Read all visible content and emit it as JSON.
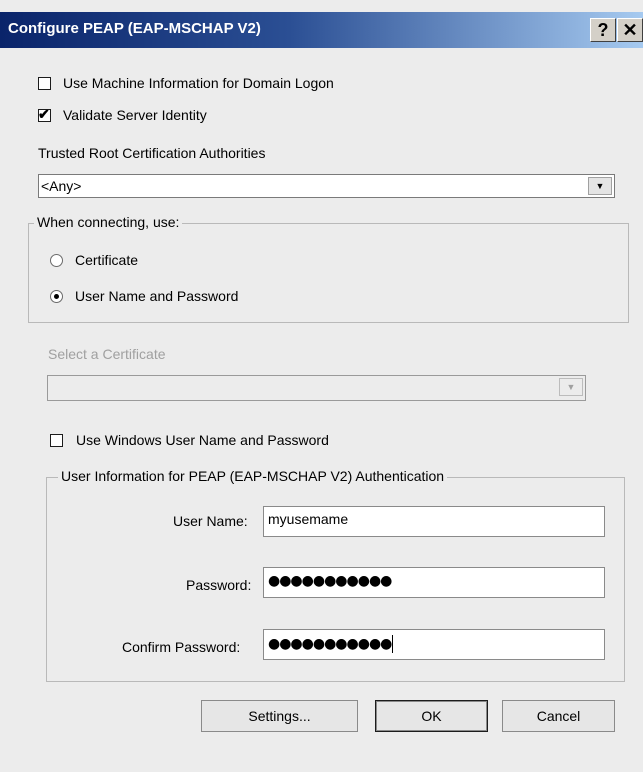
{
  "window": {
    "title": "Configure PEAP (EAP-MSCHAP V2)",
    "help_glyph": "?",
    "close_glyph": "✕"
  },
  "options": {
    "machine_info_label": "Use Machine Information for Domain Logon",
    "machine_info_checked": false,
    "validate_server_label": "Validate Server Identity",
    "validate_server_checked": true
  },
  "trusted_root": {
    "label": "Trusted Root Certification Authorities",
    "value": "<Any>"
  },
  "when_connecting": {
    "title": "When connecting, use:",
    "radio_certificate": "Certificate",
    "radio_username_password": "User Name and Password",
    "selected": "User Name and Password"
  },
  "certificate": {
    "label": "Select a Certificate",
    "value": ""
  },
  "windows_creds": {
    "label": "Use Windows User Name and Password",
    "checked": false
  },
  "user_info": {
    "title": "User Information for PEAP (EAP-MSCHAP V2) Authentication",
    "username_label": "User Name:",
    "username_value": "myusemame",
    "password_label": "Password:",
    "password_value": "●●●●●●●●●●●",
    "confirm_label": "Confirm Password:",
    "confirm_value": "●●●●●●●●●●●"
  },
  "buttons": {
    "settings": "Settings...",
    "ok": "OK",
    "cancel": "Cancel"
  }
}
